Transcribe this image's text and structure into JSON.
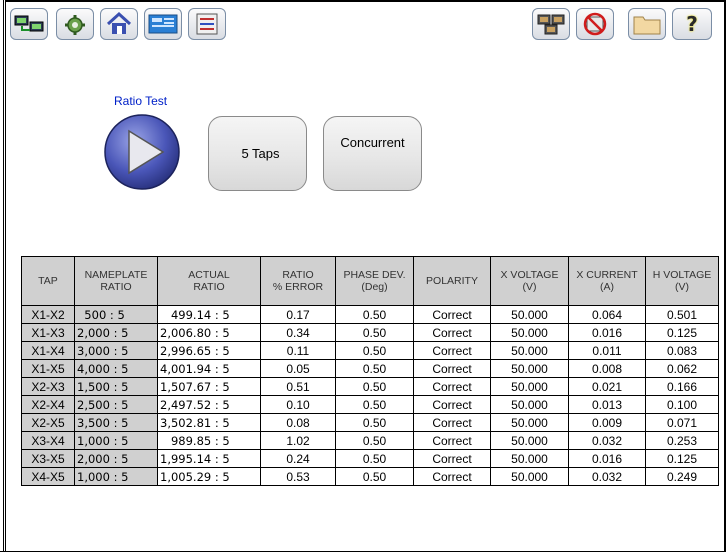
{
  "toolbar": {
    "left_icons": [
      "connection-icon",
      "settings-gear-icon",
      "home-icon",
      "data-panel-icon",
      "report-icon"
    ],
    "right_icons": [
      "network-icon",
      "no-record-icon",
      "folder-icon",
      "help-icon"
    ],
    "help_glyph": "?"
  },
  "test": {
    "title": "Ratio Test",
    "taps_label": "5 Taps",
    "mode_label": "Concurrent"
  },
  "table": {
    "headers": [
      [
        "TAP",
        ""
      ],
      [
        "NAMEPLATE",
        "RATIO"
      ],
      [
        "ACTUAL",
        "RATIO"
      ],
      [
        "RATIO",
        "% ERROR"
      ],
      [
        "PHASE DEV.",
        "(Deg)"
      ],
      [
        "POLARITY",
        ""
      ],
      [
        "X VOLTAGE",
        "(V)"
      ],
      [
        "X CURRENT",
        "(A)"
      ],
      [
        "H VOLTAGE",
        "(V)"
      ]
    ],
    "rows": [
      {
        "tap": "X1-X2",
        "nameplate": "  500 : 5",
        "actual": "   499.14 : 5",
        "error": "0.17",
        "phase": "0.50",
        "polarity": "Correct",
        "xv": "50.000",
        "xc": "0.064",
        "hv": "0.501"
      },
      {
        "tap": "X1-X3",
        "nameplate": "2,000 : 5",
        "actual": "2,006.80 : 5",
        "error": "0.34",
        "phase": "0.50",
        "polarity": "Correct",
        "xv": "50.000",
        "xc": "0.016",
        "hv": "0.125"
      },
      {
        "tap": "X1-X4",
        "nameplate": "3,000 : 5",
        "actual": "2,996.65 : 5",
        "error": "0.11",
        "phase": "0.50",
        "polarity": "Correct",
        "xv": "50.000",
        "xc": "0.011",
        "hv": "0.083"
      },
      {
        "tap": "X1-X5",
        "nameplate": "4,000 : 5",
        "actual": "4,001.94 : 5",
        "error": "0.05",
        "phase": "0.50",
        "polarity": "Correct",
        "xv": "50.000",
        "xc": "0.008",
        "hv": "0.062"
      },
      {
        "tap": "X2-X3",
        "nameplate": "1,500 : 5",
        "actual": "1,507.67 : 5",
        "error": "0.51",
        "phase": "0.50",
        "polarity": "Correct",
        "xv": "50.000",
        "xc": "0.021",
        "hv": "0.166"
      },
      {
        "tap": "X2-X4",
        "nameplate": "2,500 : 5",
        "actual": "2,497.52 : 5",
        "error": "0.10",
        "phase": "0.50",
        "polarity": "Correct",
        "xv": "50.000",
        "xc": "0.013",
        "hv": "0.100"
      },
      {
        "tap": "X2-X5",
        "nameplate": "3,500 : 5",
        "actual": "3,502.81 : 5",
        "error": "0.08",
        "phase": "0.50",
        "polarity": "Correct",
        "xv": "50.000",
        "xc": "0.009",
        "hv": "0.071"
      },
      {
        "tap": "X3-X4",
        "nameplate": "1,000 : 5",
        "actual": "   989.85 : 5",
        "error": "1.02",
        "phase": "0.50",
        "polarity": "Correct",
        "xv": "50.000",
        "xc": "0.032",
        "hv": "0.253"
      },
      {
        "tap": "X3-X5",
        "nameplate": "2,000 : 5",
        "actual": "1,995.14 : 5",
        "error": "0.24",
        "phase": "0.50",
        "polarity": "Correct",
        "xv": "50.000",
        "xc": "0.016",
        "hv": "0.125"
      },
      {
        "tap": "X4-X5",
        "nameplate": "1,000 : 5",
        "actual": "1,005.29 : 5",
        "error": "0.53",
        "phase": "0.50",
        "polarity": "Correct",
        "xv": "50.000",
        "xc": "0.032",
        "hv": "0.249"
      }
    ]
  },
  "colors": {
    "title_blue": "#0020c8",
    "header_gray": "#d0d0d0",
    "play_blue": "#4a56b8"
  }
}
